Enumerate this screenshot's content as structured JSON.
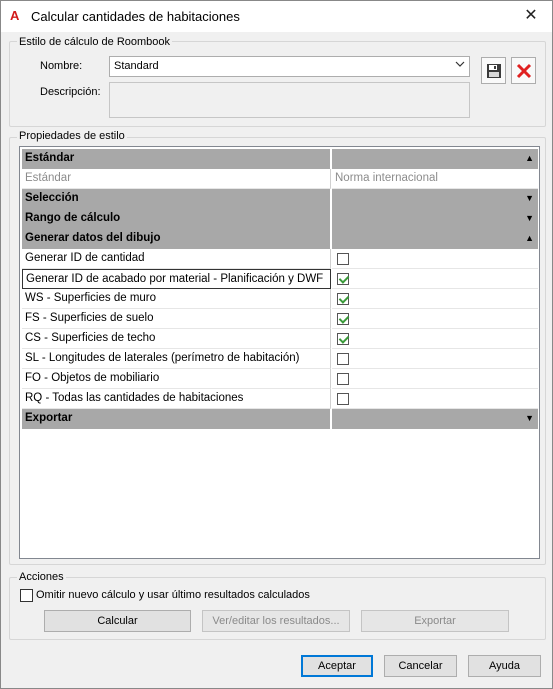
{
  "window": {
    "title": "Calcular cantidades de habitaciones",
    "close_glyph": "✕"
  },
  "style_group": {
    "label": "Estilo de cálculo de Roombook",
    "name_label": "Nombre:",
    "name_value": "Standard",
    "description_label": "Descripción:"
  },
  "properties": {
    "label": "Propiedades de estilo",
    "rows": [
      {
        "type": "category",
        "label": "Estándar",
        "expanded": true,
        "arrow": "▲"
      },
      {
        "type": "text",
        "label": "Estándar",
        "value": "Norma internacional",
        "disabled": true
      },
      {
        "type": "category",
        "label": "Selección",
        "expanded": false,
        "arrow": "▼"
      },
      {
        "type": "category",
        "label": "Rango de cálculo",
        "expanded": false,
        "arrow": "▼"
      },
      {
        "type": "category",
        "label": "Generar datos del dibujo",
        "expanded": true,
        "arrow": "▲"
      },
      {
        "type": "check",
        "label": "Generar ID de cantidad",
        "checked": false
      },
      {
        "type": "check",
        "label": "Generar ID de acabado por material - Planificación y DWF",
        "checked": true,
        "selected": true
      },
      {
        "type": "check",
        "label": "WS - Superficies de muro",
        "checked": true
      },
      {
        "type": "check",
        "label": "FS - Superficies de suelo",
        "checked": true
      },
      {
        "type": "check",
        "label": "CS - Superficies de techo",
        "checked": true
      },
      {
        "type": "check",
        "label": "SL - Longitudes de laterales (perímetro de habitación)",
        "checked": false
      },
      {
        "type": "check",
        "label": "FO - Objetos de mobiliario",
        "checked": false
      },
      {
        "type": "check",
        "label": "RQ - Todas las cantidades de habitaciones",
        "checked": false
      },
      {
        "type": "category",
        "label": "Exportar",
        "expanded": false,
        "arrow": "▼"
      }
    ]
  },
  "actions": {
    "label": "Acciones",
    "omit_checkbox_label": "Omitir nuevo cálculo y usar último resultados calculados",
    "omit_checked": false,
    "calculate_label": "Calcular",
    "view_edit_label": "Ver/editar los resultados...",
    "export_label": "Exportar"
  },
  "footer": {
    "accept_label": "Aceptar",
    "cancel_label": "Cancelar",
    "help_label": "Ayuda"
  },
  "colors": {
    "category_bg": "#a8a8a8",
    "check_green": "#3a9a3a",
    "delete_red": "#e02020",
    "accent_blue": "#0078d7"
  },
  "icons": {
    "app": "autocad-a-icon",
    "save": "floppy-disk-icon",
    "delete": "red-x-icon"
  }
}
